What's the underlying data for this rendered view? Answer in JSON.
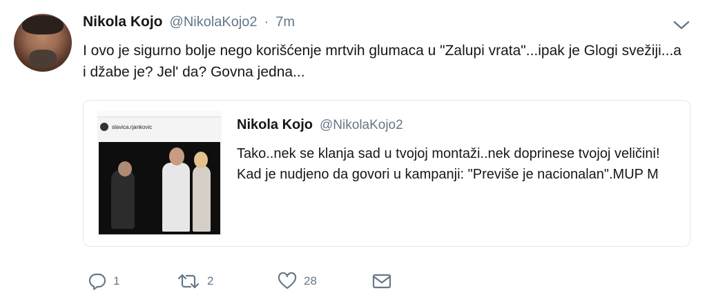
{
  "tweet": {
    "display_name": "Nikola Kojo",
    "handle": "@NikolaKojo2",
    "separator": "·",
    "time": "7m",
    "text": "I ovo je sigurno bolje nego korišćenje mrtvih glumaca u \"Zalupi vrata\"...ipak je Glogi svežiji...a i džabe je? Jel' da? Govna jedna...",
    "menu_icon": "chevron-down-icon"
  },
  "quote": {
    "display_name": "Nikola Kojo",
    "handle": "@NikolaKojo2",
    "text": "Tako..nek se klanja sad u tvojoj montaži..nek doprinese tvojoj veličini! Kad je nudjeno da govori u kampanji: \"Previše je nacionalan\".MUP M",
    "image": {
      "username": "slavica.rjankovic"
    }
  },
  "actions": {
    "reply": {
      "icon": "reply-icon",
      "count": "1"
    },
    "retweet": {
      "icon": "retweet-icon",
      "count": "2"
    },
    "like": {
      "icon": "heart-icon",
      "count": "28"
    },
    "dm": {
      "icon": "envelope-icon"
    }
  },
  "colors": {
    "text": "#14171a",
    "secondary": "#657786",
    "border": "#e1e8ed"
  }
}
